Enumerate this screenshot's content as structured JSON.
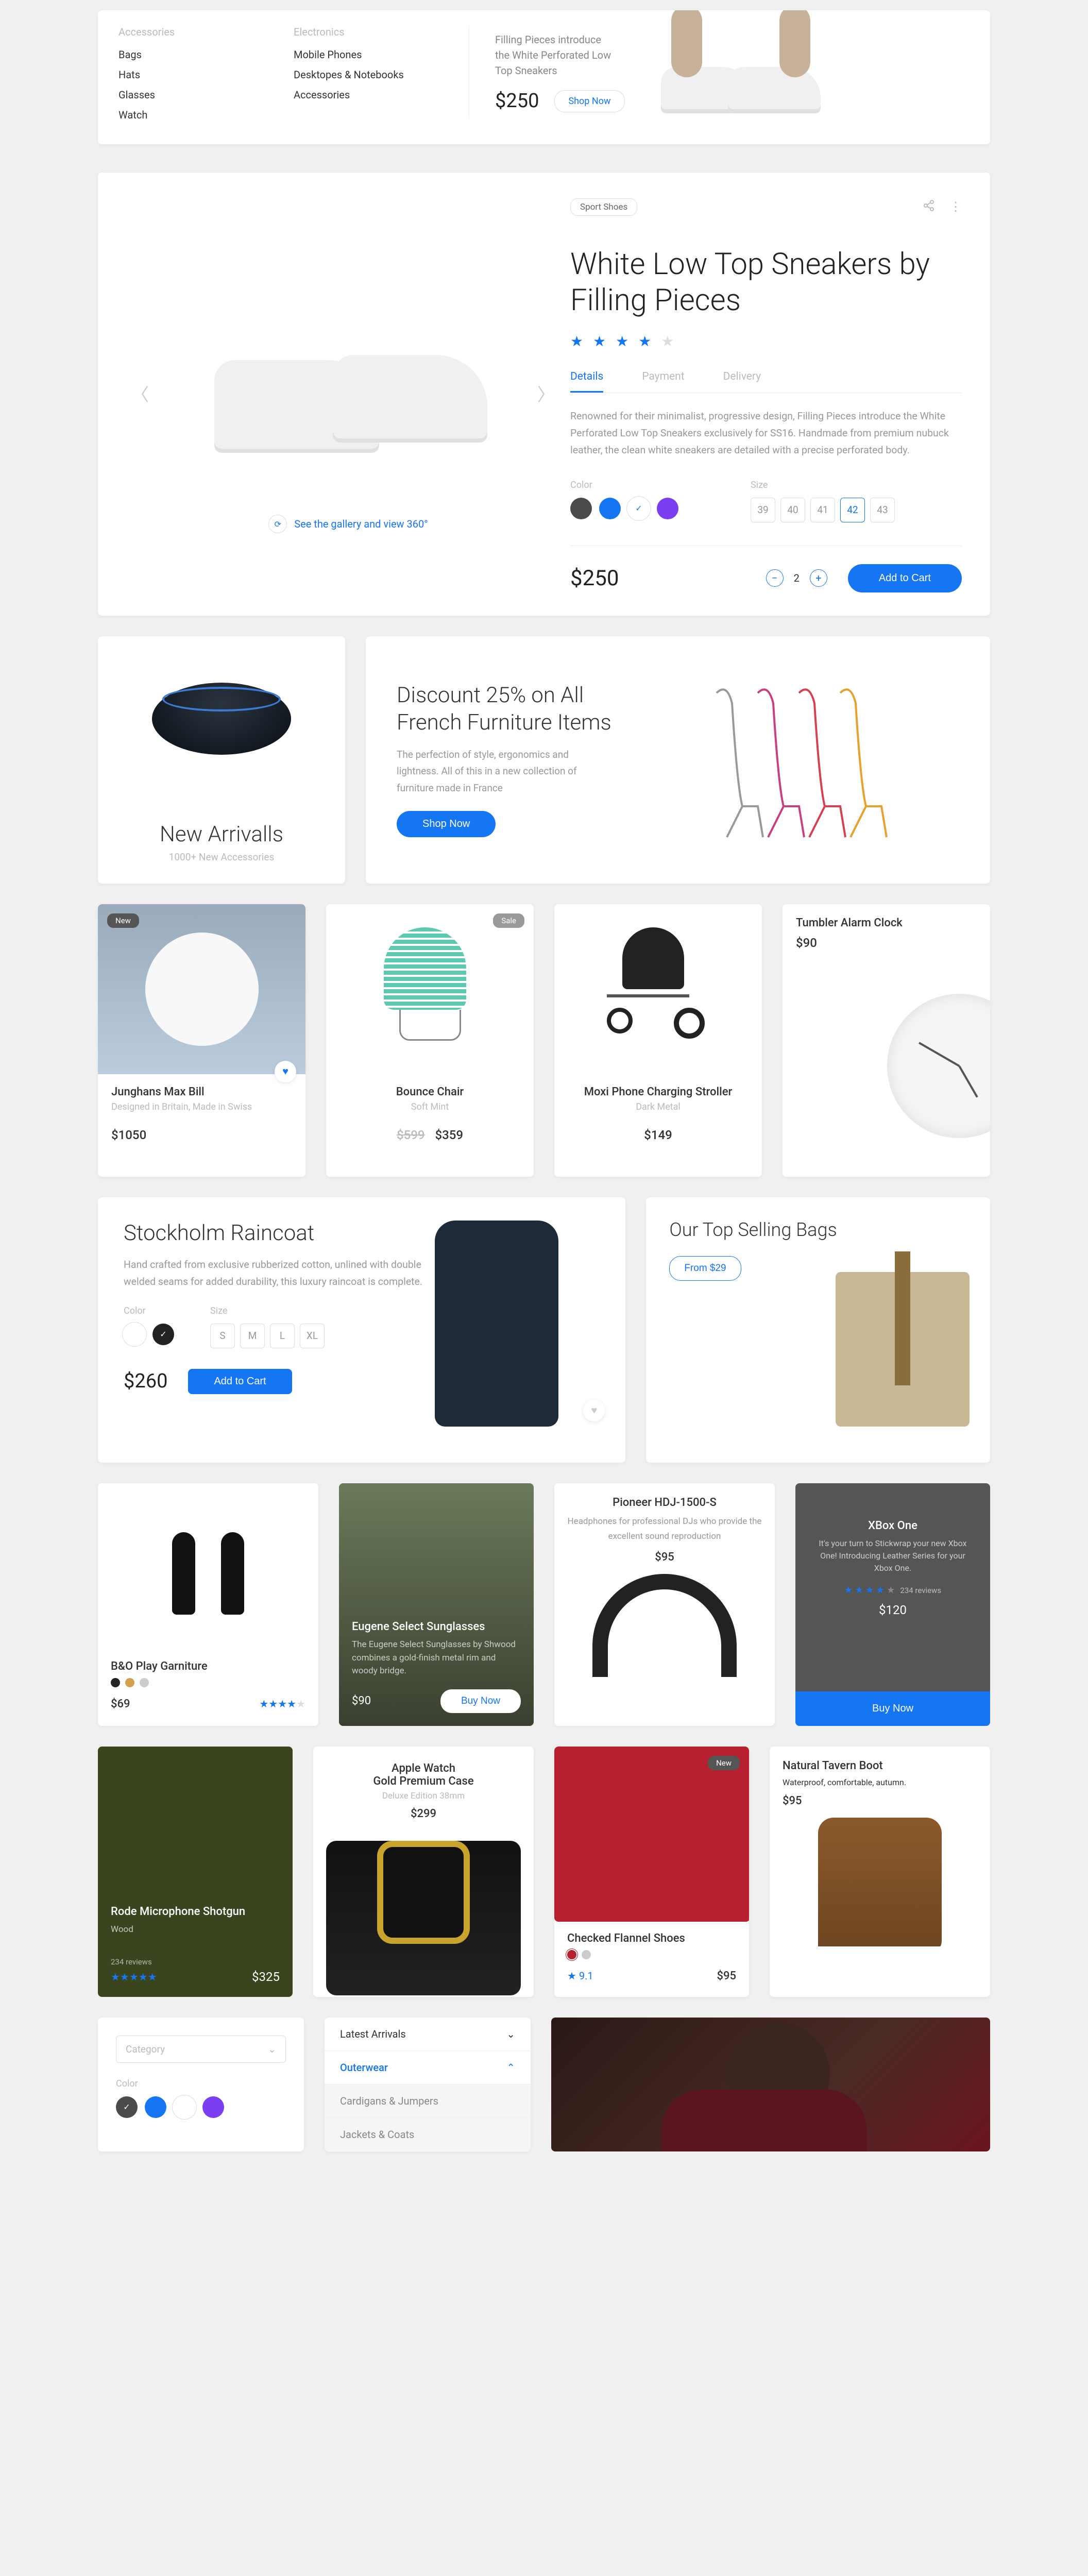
{
  "nav": {
    "col1": {
      "header": "Accessories",
      "items": [
        "Bags",
        "Hats",
        "Glasses",
        "Watch"
      ]
    },
    "col2": {
      "header": "Electronics",
      "items": [
        "Mobile Phones",
        "Desktopes & Notebooks",
        "Accessories"
      ]
    },
    "promo": {
      "line1": "Filling Pieces introduce",
      "line2": "the White Perforated Low",
      "line3": "Top Sneakers",
      "price": "$250",
      "cta": "Shop Now"
    }
  },
  "product": {
    "tag": "Sport Shoes",
    "title": "White Low Top Sneakers by Filling Pieces",
    "rating": 4,
    "tabs": {
      "details": "Details",
      "payment": "Payment",
      "delivery": "Delivery"
    },
    "desc": "Renowned for their minimalist, progressive design, Filling Pieces introduce the White Perforated Low Top Sneakers exclusively for SS16. Handmade from premium nubuck leather, the clean white sneakers are detailed with a precise perforated body.",
    "color_label": "Color",
    "size_label": "Size",
    "colors": [
      "#4b4b4b",
      "#1476f2",
      "#ffffff",
      "#7b3ff2"
    ],
    "color_selected": 2,
    "sizes": [
      "39",
      "40",
      "41",
      "42",
      "43"
    ],
    "size_selected": "42",
    "price": "$250",
    "qty": "2",
    "add_to_cart": "Add to Cart",
    "gallery_cta": "See the gallery and view 360°"
  },
  "arrivals": {
    "title": "New Arrivalls",
    "sub": "1000+ New Accessories"
  },
  "discount": {
    "title": "Discount 25% on All French Furniture Items",
    "desc": "The perfection of style, ergonomics and lightness. All of this in a new collection of furniture made in France",
    "cta": "Shop Now"
  },
  "row4": {
    "watch": {
      "badge": "New",
      "title": "Junghans Max Bill",
      "sub": "Designed in Britain, Made in Swiss",
      "price": "$1050"
    },
    "chair": {
      "badge": "Sale",
      "title": "Bounce Chair",
      "sub": "Soft Mint",
      "old": "$599",
      "price": "$359"
    },
    "stroller": {
      "title": "Moxi Phone Charging Stroller",
      "sub": "Dark Metal",
      "price": "$149"
    },
    "clock": {
      "title": "Tumbler Alarm Clock",
      "price": "$90"
    }
  },
  "raincoat": {
    "title": "Stockholm Raincoat",
    "desc": "Hand crafted from exclusive rubberized cotton, unlined with double welded seams for added durability, this luxury raincoat is complete.",
    "color_label": "Color",
    "size_label": "Size",
    "sizes": [
      "S",
      "M",
      "L",
      "XL"
    ],
    "price": "$260",
    "cta": "Add to Cart"
  },
  "bags": {
    "title": "Our Top Selling Bags",
    "cta": "From $29"
  },
  "row6": {
    "beo": {
      "title": "B&O Play Garniture",
      "price": "$69",
      "rating": 4
    },
    "sun": {
      "title": "Eugene Select Sunglasses",
      "desc": "The Eugene Select Sunglasses by Shwood combines a gold-finish metal rim and woody bridge.",
      "price": "$90",
      "cta": "Buy Now"
    },
    "hdj": {
      "title": "Pioneer HDJ-1500-S",
      "desc": "Headphones for professional DJs who provide the excellent sound reproduction",
      "price": "$95"
    },
    "xbox": {
      "title": "XBox One",
      "desc": "It's your turn to Stickwrap your new Xbox One! Introducing Leather Series for your Xbox One.",
      "reviews": "234 reviews",
      "price": "$120",
      "cta": "Buy Now",
      "rating": 4
    }
  },
  "row7": {
    "rode": {
      "title": "Rode Microphone Shotgun",
      "sub": "Wood",
      "reviews": "234 reviews",
      "price": "$325",
      "rating": 5
    },
    "apple": {
      "title1": "Apple Watch",
      "title2": "Gold Premium Case",
      "sub": "Deluxe Edition 38mm",
      "price": "$299"
    },
    "flannel": {
      "badge": "New",
      "title": "Checked Flannel Shoes",
      "rating_val": "9.1",
      "price": "$95"
    },
    "boot": {
      "title": "Natural Tavern Boot",
      "sub": "Waterproof, comfortable, autumn.",
      "price": "$95"
    }
  },
  "filters": {
    "category_ph": "Category",
    "color_label": "Color",
    "colors": [
      "#4b4b4b",
      "#1476f2",
      "#ffffff",
      "#7b3ff2"
    ],
    "accordion": [
      "Latest Arrivals",
      "Outerwear",
      "Cardigans & Jumpers",
      "Jackets & Coats"
    ],
    "active": 1
  }
}
